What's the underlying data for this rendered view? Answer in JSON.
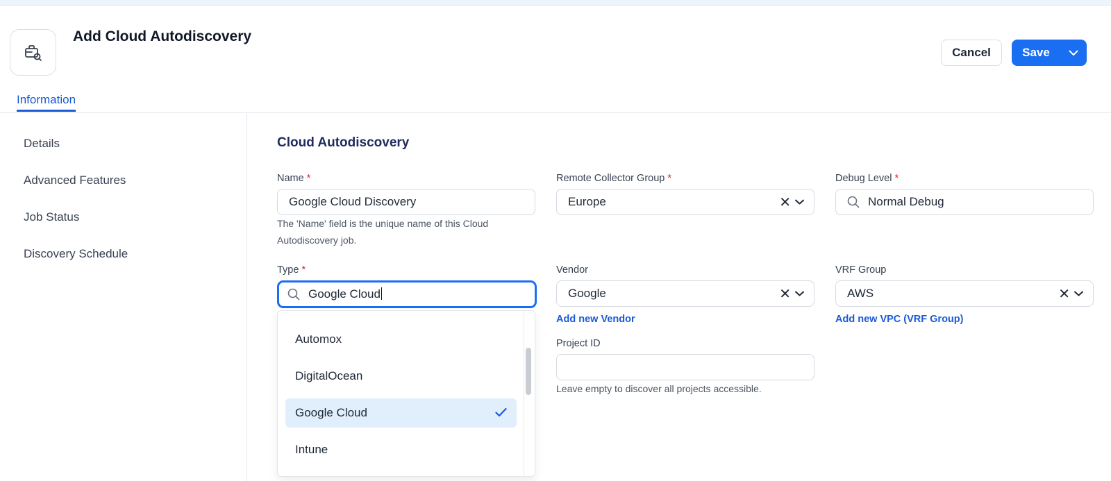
{
  "header": {
    "title": "Add Cloud Autodiscovery",
    "cancel_label": "Cancel",
    "save_label": "Save"
  },
  "tabs": [
    {
      "label": "Information",
      "active": true
    }
  ],
  "sidebar": {
    "items": [
      {
        "label": "Details"
      },
      {
        "label": "Advanced Features"
      },
      {
        "label": "Job Status"
      },
      {
        "label": "Discovery Schedule"
      }
    ]
  },
  "form": {
    "section_title": "Cloud Autodiscovery",
    "required_mark": "*",
    "name": {
      "label": "Name",
      "value": "Google Cloud Discovery",
      "help": "The 'Name' field is the unique name of this Cloud Autodiscovery job."
    },
    "remote_collector_group": {
      "label": "Remote Collector Group",
      "value": "Europe"
    },
    "debug_level": {
      "label": "Debug Level",
      "value": "Normal Debug"
    },
    "type": {
      "label": "Type",
      "search_value": "Google Cloud",
      "options": [
        {
          "label": "Automox",
          "selected": false
        },
        {
          "label": "DigitalOcean",
          "selected": false
        },
        {
          "label": "Google Cloud",
          "selected": true
        },
        {
          "label": "Intune",
          "selected": false
        }
      ]
    },
    "vendor": {
      "label": "Vendor",
      "value": "Google",
      "add_link": "Add new Vendor"
    },
    "vrf_group": {
      "label": "VRF Group",
      "value": "AWS",
      "add_link": "Add new VPC (VRF Group)"
    },
    "project_id": {
      "label": "Project ID",
      "value": "",
      "help": "Leave empty to discover all projects accessible."
    }
  },
  "colors": {
    "accent": "#1a6ef2",
    "link": "#1a5bd6",
    "required": "#dc2626",
    "selected_option": "#e1eefc"
  }
}
